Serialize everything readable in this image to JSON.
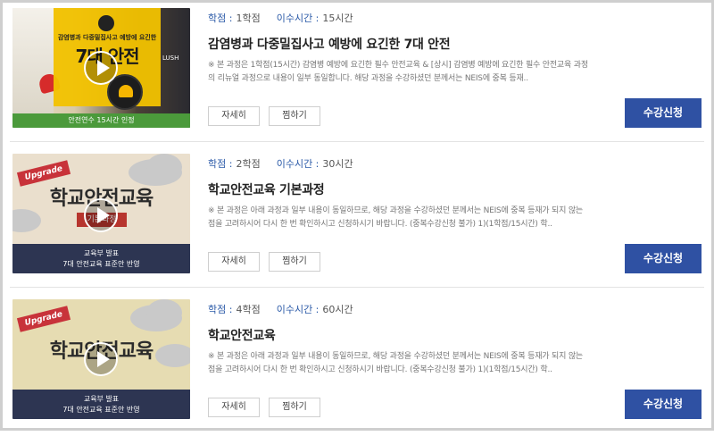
{
  "labels": {
    "credit_key": "학점 :",
    "hours_key": "이수시간 :",
    "detail_button": "자세히",
    "wishlist_button": "찜하기",
    "apply_button": "수강신청"
  },
  "courses": [
    {
      "credit": "1학점",
      "hours": "15시간",
      "title": "감염병과 다중밀집사고 예방에 요긴한 7대 안전",
      "description": "※ 본 과정은 1학점(15시간) 감염병 예방에 요긴한 필수 안전교육 & [상시] 감염병 예방에 요긴한 필수 안전교육 과정의 리뉴얼 과정으로 내용이 일부 동일합니다. 해당 과정을 수강하셨던 분께서는 NEIS에 중복 등재..",
      "thumb": {
        "header": "감염병과 다중밀집사고 예방에 요긴한",
        "big": "7대 안전",
        "band": "안전연수 15시간 인정",
        "sign": "LUSH"
      }
    },
    {
      "credit": "2학점",
      "hours": "30시간",
      "title": "학교안전교육 기본과정",
      "description": "※ 본 과정은 아래 과정과 일부 내용이 동일하므로, 해당 과정을 수강하셨던 분께서는 NEIS에 중복 등재가 되지 않는 점을 고려하시어 다시 한 번 확인하시고 신청하시기 바랍니다. (중복수강신청 불가) 1)(1학점/15시간) 학..",
      "thumb": {
        "ribbon": "Upgrade",
        "big": "학교안전교육",
        "tag": "기본과정",
        "line1": "교육부 발표",
        "line2": "7대 안전교육 표준안 반영"
      }
    },
    {
      "credit": "4학점",
      "hours": "60시간",
      "title": "학교안전교육",
      "description": "※ 본 과정은 아래 과정과 일부 내용이 동일하므로, 해당 과정을 수강하셨던 분께서는 NEIS에 중복 등재가 되지 않는 점을 고려하시어 다시 한 번 확인하시고 신청하시기 바랍니다. (중복수강신청 불가) 1)(1학점/15시간) 학..",
      "thumb": {
        "ribbon": "Upgrade",
        "big": "학교안전교육",
        "line1": "교육부 발표",
        "line2": "7대 안전교육 표준안 반영"
      }
    }
  ],
  "colors": {
    "accent": "#2f51a3",
    "meta_key": "#2b5aa8",
    "green_band": "#4b9a3b",
    "navy_band": "#2d3552"
  }
}
